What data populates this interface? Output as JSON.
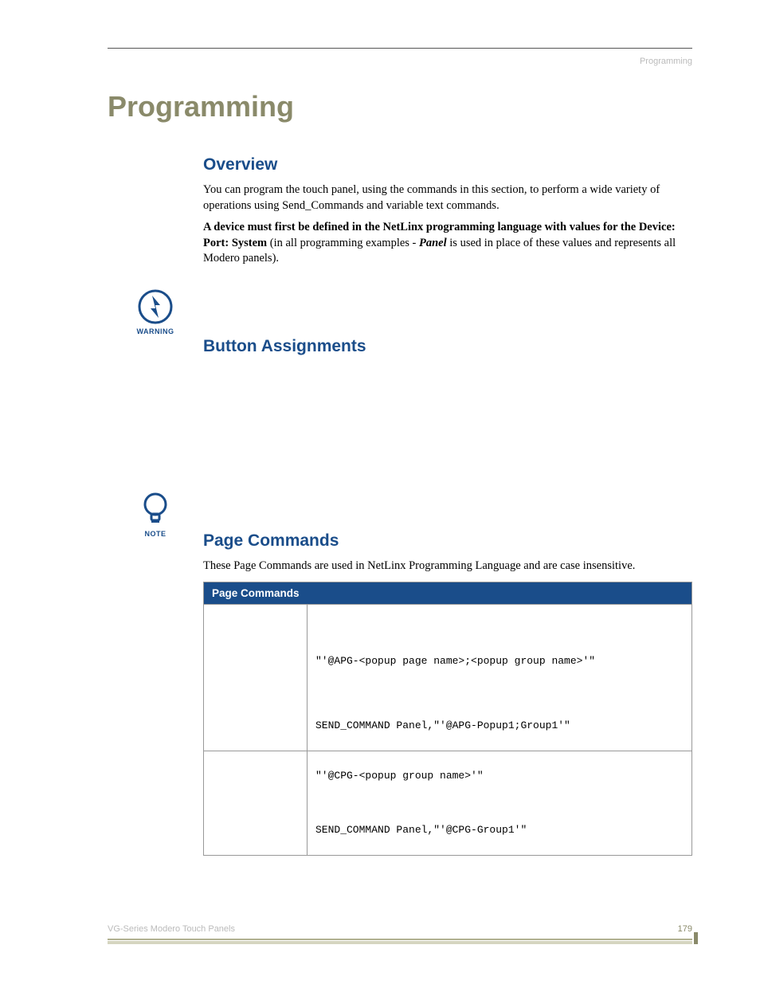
{
  "header_right": "Programming",
  "page_title": "Programming",
  "overview": {
    "heading": "Overview",
    "p1": "You can program the touch panel, using the commands in this section, to perform a wide variety of operations using Send_Commands and variable text commands.",
    "p2a": "A device must first be defined in the NetLinx programming language with values for the Device: Port: System",
    "p2b": " (in all programming examples - ",
    "p2c": "Panel",
    "p2d": " is used in place of these values and represents all Modero panels)."
  },
  "warning_label": "WARNING",
  "button_heading": "Button Assignments",
  "note_label": "NOTE",
  "page_cmds": {
    "heading": "Page Commands",
    "intro": "These Page Commands are used in NetLinx Programming Language and are case insensitive.",
    "table_header": "Page Commands",
    "rows": [
      {
        "code1": "\"'@APG-<popup page name>;<popup group name>'\"",
        "code2": "SEND_COMMAND Panel,\"'@APG-Popup1;Group1'\""
      },
      {
        "code1": "\"'@CPG-<popup group name>'\"",
        "code2": "SEND_COMMAND Panel,\"'@CPG-Group1'\""
      }
    ]
  },
  "footer_left": "VG-Series Modero Touch Panels",
  "footer_right": "179"
}
